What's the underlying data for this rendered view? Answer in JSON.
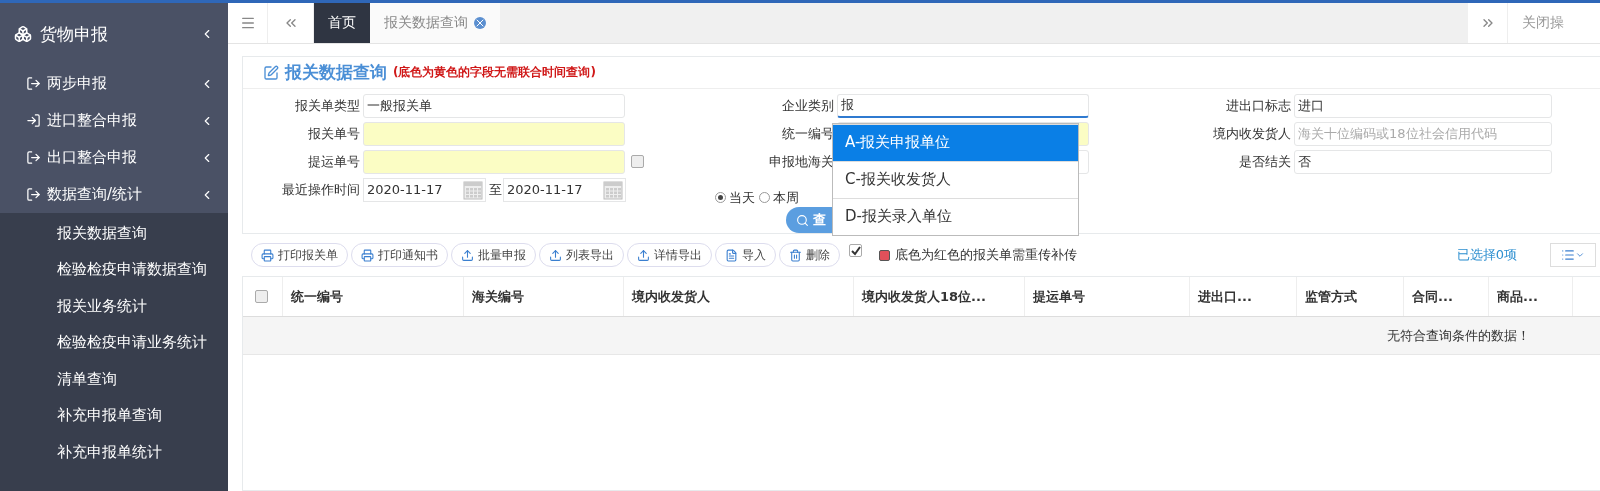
{
  "sidebar": {
    "title": "货物申报",
    "groups": [
      {
        "label": "两步申报",
        "kind": "out"
      },
      {
        "label": "进口整合申报",
        "kind": "in"
      },
      {
        "label": "出口整合申报",
        "kind": "out"
      },
      {
        "label": "数据查询/统计",
        "kind": "out"
      }
    ],
    "sub_items": [
      "报关数据查询",
      "检验检疫申请数据查询",
      "报关业务统计",
      "检验检疫申请业务统计",
      "清单查询",
      "补充申报单查询",
      "补充申报单统计"
    ]
  },
  "tabs": [
    {
      "label": "首页",
      "selected": true,
      "closable": false
    },
    {
      "label": "报关数据查询",
      "selected": false,
      "closable": true
    }
  ],
  "close_tabs_label": "关闭操",
  "panel": {
    "title": "报关数据查询",
    "note": "(底色为黄色的字段无需联合时间查询)"
  },
  "form": {
    "rows": [
      [
        {
          "kind": "input",
          "label": "报关单类型",
          "value": "一般报关单",
          "highlight": false,
          "focused": false
        },
        {
          "kind": "input",
          "label": "企业类别",
          "value": "报",
          "highlight": false,
          "focused": true
        },
        {
          "kind": "input",
          "label": "进出口标志",
          "value": "进口",
          "highlight": false,
          "focused": false
        }
      ],
      [
        {
          "kind": "input",
          "label": "报关单号",
          "highlight": true,
          "focused": false
        },
        {
          "kind": "input",
          "label": "统一编号",
          "highlight": true,
          "focused": false
        },
        {
          "kind": "input",
          "label": "境内收发货人",
          "placeholder": "海关十位编码或18位社会信用代码",
          "highlight": false,
          "focused": false
        }
      ],
      [
        {
          "kind": "input",
          "label": "提运单号",
          "highlight": true,
          "focused": false,
          "checkbox": {
            "checked": false
          }
        },
        {
          "kind": "input",
          "label": "申报地海关",
          "highlight": false,
          "focused": false
        },
        {
          "kind": "input",
          "label": "是否结关",
          "value": "否",
          "highlight": false,
          "focused": false
        }
      ],
      [
        {
          "kind": "date_range",
          "label": "最近操作时间",
          "from": "2020-11-17",
          "separator": "至",
          "to": "2020-11-17"
        },
        {
          "kind": "radios",
          "options": [
            {
              "label": "当天",
              "selected": true
            },
            {
              "label": "本周",
              "selected": false
            }
          ]
        },
        {
          "kind": "empty"
        }
      ]
    ],
    "query_button": "查"
  },
  "dropdown": {
    "options": [
      {
        "label": "A-报关申报单位",
        "selected": true
      },
      {
        "label": "C-报关收发货人",
        "selected": false
      },
      {
        "label": "D-报关录入单位",
        "selected": false
      }
    ]
  },
  "toolbar": {
    "buttons": [
      {
        "label": "打印报关单"
      },
      {
        "label": "打印通知书"
      },
      {
        "label": "批量申报"
      },
      {
        "label": "列表导出"
      },
      {
        "label": "详情导出"
      },
      {
        "label": "导入"
      },
      {
        "label": "删除"
      }
    ],
    "option_checked": true,
    "legend": "底色为红色的报关单需重传补传",
    "selected_count": "已选择0项"
  },
  "table": {
    "header_checked": false,
    "columns": [
      "统一编号",
      "海关编号",
      "境内收发货人",
      "境内收发货人18位...",
      "提运单号",
      "进出口...",
      "监管方式",
      "合同...",
      "商品..."
    ],
    "empty_message": "无符合查询条件的数据！"
  }
}
